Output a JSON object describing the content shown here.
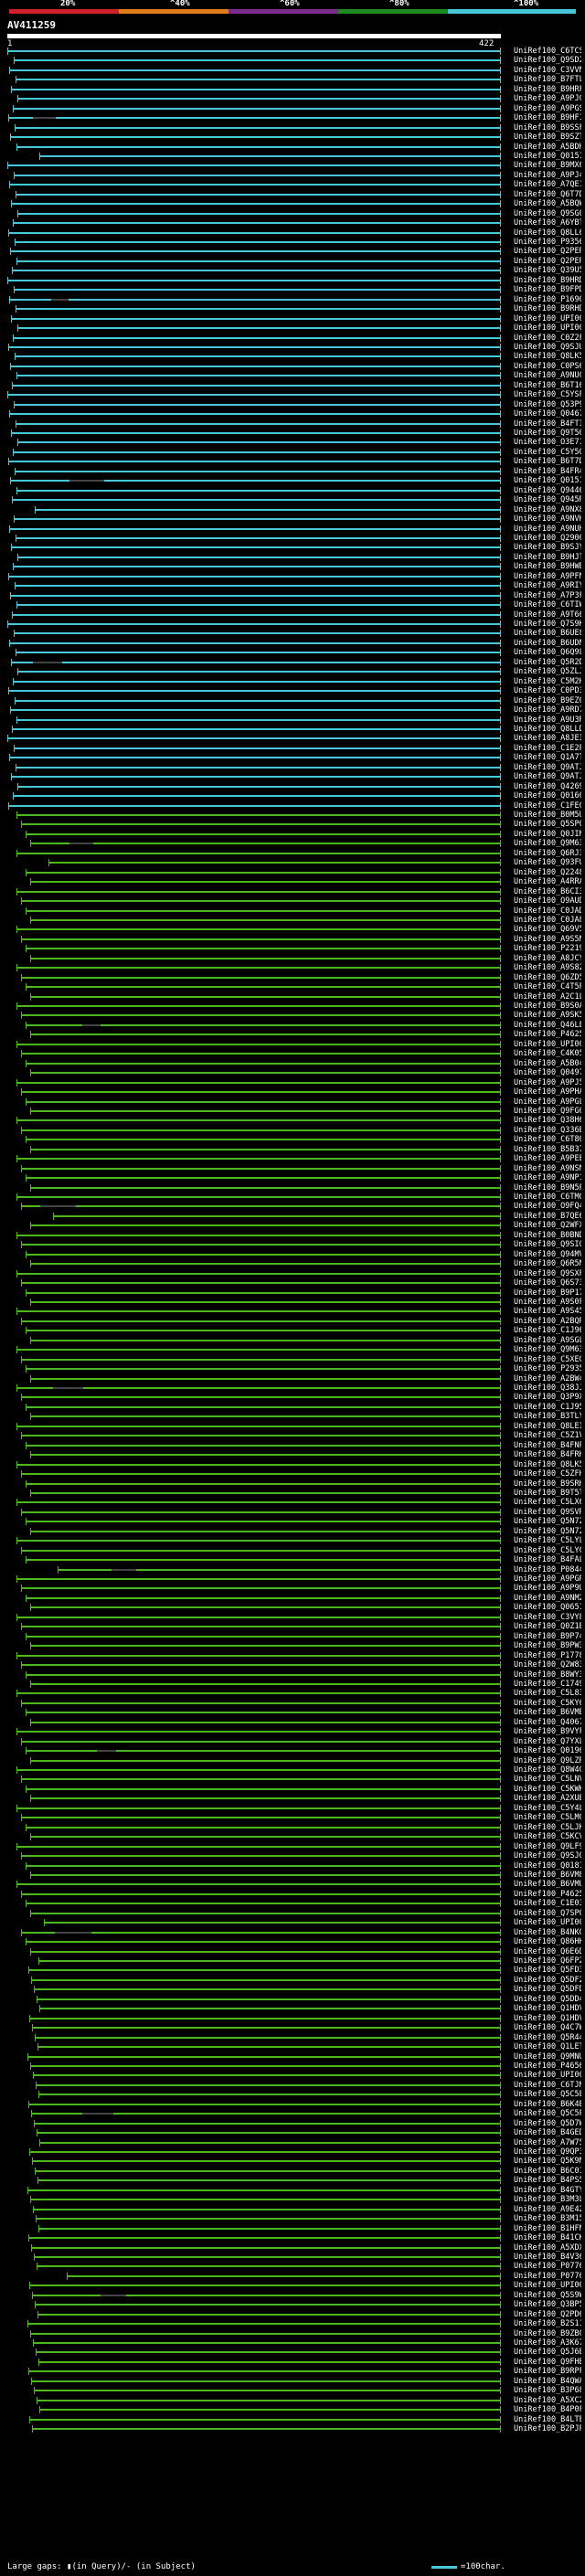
{
  "scale": {
    "labels": [
      "20%",
      "^40%",
      "^60%",
      "^80%",
      "^100%"
    ],
    "colors": [
      "#d0202a",
      "#e07b1a",
      "#7a2b8c",
      "#1f8a1f",
      "#46c8d8"
    ]
  },
  "query": {
    "title": "AV411259",
    "start": "1",
    "end": "422"
  },
  "colors": {
    "cyan": "#46c8d8",
    "green": "#4db81c"
  },
  "hits": [
    "UniRef100_C6TCS3",
    "UniRef100_Q9SD24",
    "UniRef100_C3VVN9",
    "UniRef100_B7FTL9",
    "UniRef100_B9HRF9",
    "UniRef100_A9PJC9",
    "UniRef100_A9PGS7",
    "UniRef100_B9HF14",
    "UniRef100_B9SSF5",
    "UniRef100_B9SZT9",
    "UniRef100_A5BDH7",
    "UniRef100_Q01516",
    "UniRef100_B9MX67",
    "UniRef100_A9PJ44",
    "UniRef100_A7QE19",
    "UniRef100_Q6T7D6",
    "UniRef100_A5BQW0",
    "UniRef100_Q9SG03",
    "UniRef100_A6YBT3",
    "UniRef100_Q8LL68",
    "UniRef100_P93565",
    "UniRef100_Q2PER4",
    "UniRef100_Q2PER4",
    "UniRef100_Q39U50",
    "UniRef100_B9HRD9",
    "UniRef100_B9FPD8",
    "UniRef100_P16906",
    "UniRef100_B9RHD4",
    "UniRef100_UPI000...",
    "UniRef100_UPI000...",
    "UniRef100_C0Z2F2",
    "UniRef100_Q9SJU4",
    "UniRef100_Q8LK59",
    "UniRef100_C0PS67",
    "UniRef100_A9NUC9",
    "UniRef100_B6T165",
    "UniRef100_C5YSP7",
    "UniRef100_Q53P96",
    "UniRef100_Q04677",
    "UniRef100_B4FTI5",
    "UniRef100_Q9T509",
    "UniRef100_O3E716",
    "UniRef100_C5Y5Q8",
    "UniRef100_B6T7D4",
    "UniRef100_B4FR47",
    "UniRef100_Q01517",
    "UniRef100_Q94469",
    "UniRef100_Q945R6",
    "UniRef100_A9NX85",
    "UniRef100_A9NVH7",
    "UniRef100_A9NUH5",
    "UniRef100_Q29000",
    "UniRef100_B9SJY9",
    "UniRef100_B9HJT3",
    "UniRef100_B9HWB3",
    "UniRef100_A9PFN5",
    "UniRef100_A9RIY9",
    "UniRef100_A7P3F7",
    "UniRef100_C6TIW0",
    "UniRef100_A9T663",
    "UniRef100_Q7S9K7",
    "UniRef100_B6UE86",
    "UniRef100_B6UDN1",
    "UniRef100_Q6Q9L9",
    "UniRef100_Q5R2D3",
    "UniRef100_Q5ZLJ0",
    "UniRef100_C5M2H1",
    "UniRef100_C0PD30",
    "UniRef100_B9EZ03",
    "UniRef100_A9RD76",
    "UniRef100_A9U3R4",
    "UniRef100_Q8LLD7",
    "UniRef100_A8JEI0",
    "UniRef100_C1E2P3",
    "UniRef100_Q1A7T7",
    "UniRef100_Q9ATJ0",
    "UniRef100_Q9ATJ1",
    "UniRef100_Q42690",
    "UniRef100_Q01600",
    "UniRef100_C1FEC9",
    "UniRef100_B0M5U3",
    "UniRef100_Q5SP09",
    "UniRef100_Q0JIM2",
    "UniRef100_Q9M633",
    "UniRef100_Q6RJ32",
    "UniRef100_Q93FU6",
    "UniRef100_Q22486",
    "UniRef100_A4RRA1",
    "UniRef100_B6CI36",
    "UniRef100_O9AUD9",
    "UniRef100_C0JAD2",
    "UniRef100_C0JA86",
    "UniRef100_Q69V57",
    "UniRef100_A9S5N9",
    "UniRef100_P22197",
    "UniRef100_A8JCY4",
    "UniRef100_A9S821",
    "UniRef100_Q6ZD51",
    "UniRef100_C4T5P1",
    "UniRef100_A2C1L8",
    "UniRef100_B9S0A4",
    "UniRef100_A9SK58",
    "UniRef100_Q46LE8",
    "UniRef100_P46256",
    "UniRef100_UPI000...",
    "UniRef100_C4K058",
    "UniRef100_A5B043",
    "UniRef100_Q04975",
    "UniRef100_A9PJ53",
    "UniRef100_A9PHA1",
    "UniRef100_A9PGL3",
    "UniRef100_Q9FG07",
    "UniRef100_Q38H64",
    "UniRef100_Q336B5",
    "UniRef100_C6T808",
    "UniRef100_B5B374",
    "UniRef100_A9PEE1",
    "UniRef100_A9NSN4",
    "UniRef100_A9NP14",
    "UniRef100_B9N5P0",
    "UniRef100_C6TMG1",
    "UniRef100_O9FQ46",
    "UniRef100_B7QE67",
    "UniRef100_Q2WFX0",
    "UniRef100_B0BND7",
    "UniRef100_Q9SIQ3",
    "UniRef100_Q94MV9",
    "UniRef100_Q6R5N7",
    "UniRef100_Q9SXP6",
    "UniRef100_Q6S735",
    "UniRef100_B9P179",
    "UniRef100_A9S0F9",
    "UniRef100_A9S450",
    "UniRef100_A2BQR8",
    "UniRef100_C1J960",
    "UniRef100_A9SGL4",
    "UniRef100_Q9M634",
    "UniRef100_C5XEQ7",
    "UniRef100_P29356",
    "UniRef100_A2BW48",
    "UniRef100_Q38JJ4",
    "UniRef100_Q3P9X3",
    "UniRef100_C1J959",
    "UniRef100_B3TLY1",
    "UniRef100_Q8LEI8",
    "UniRef100_C5Z1V3",
    "UniRef100_B4FNP9",
    "UniRef100_B4FRH3",
    "UniRef100_Q8LK58",
    "UniRef100_C5ZFH6",
    "UniRef100_B9SRH4",
    "UniRef100_B9T5T6",
    "UniRef100_C5LX67",
    "UniRef100_Q9SVR7",
    "UniRef100_Q5N725",
    "UniRef100_Q5N726",
    "UniRef100_C5LYL8",
    "UniRef100_C5LYC0",
    "UniRef100_B4FAL9",
    "UniRef100_P08440",
    "UniRef100_A9PGR9",
    "UniRef100_A9P9U1",
    "UniRef100_A9NM20",
    "UniRef100_Q06518",
    "UniRef100_C3VY85",
    "UniRef100_Q0Z1B5",
    "UniRef100_B9P741",
    "UniRef100_B9PW34",
    "UniRef100_P17784",
    "UniRef100_Q2W830",
    "UniRef100_B8WY35",
    "UniRef100_C17497",
    "UniRef100_C5L831",
    "UniRef100_C5KY69",
    "UniRef100_B6VMB7",
    "UniRef100_Q40676",
    "UniRef100_B9VYF4",
    "UniRef100_Q7YXL7",
    "UniRef100_Q01964",
    "UniRef100_Q9LZR9",
    "UniRef100_Q8W4G8",
    "UniRef100_C5LNV8",
    "UniRef100_C5KWK0",
    "UniRef100_A2XUB6",
    "UniRef100_C5Y4L0",
    "UniRef100_C5LMC2",
    "UniRef100_C5LJK3",
    "UniRef100_C5KCV7",
    "UniRef100_Q9LF98",
    "UniRef100_Q9SJQ9",
    "UniRef100_Q01812",
    "UniRef100_B6VM86",
    "UniRef100_B6VMU3",
    "UniRef100_P46257",
    "UniRef100_C1E032",
    "UniRef100_Q7SP03",
    "UniRef100_UPI000...",
    "UniRef100_B4NKG7",
    "UniRef100_Q86HK7",
    "UniRef100_Q6E6D2",
    "UniRef100_Q6FP29",
    "UniRef100_Q5FD38",
    "UniRef100_Q5DF28",
    "UniRef100_Q5DFD3",
    "UniRef100_Q5DD43",
    "UniRef100_Q1HDV3",
    "UniRef100_Q1HDV2",
    "UniRef100_Q4C7W5",
    "UniRef100_Q5R443",
    "UniRef100_Q1LET3",
    "UniRef100_Q9MNU1",
    "UniRef100_P46563",
    "UniRef100_UPI000...",
    "UniRef100_C6TJM1",
    "UniRef100_Q5C5E9",
    "UniRef100_B6K4B7",
    "UniRef100_Q5C5P7",
    "UniRef100_Q5D7W9",
    "UniRef100_B4GED5",
    "UniRef100_A7W751",
    "UniRef100_Q9QP32",
    "UniRef100_Q5K9N1",
    "UniRef100_B6C019",
    "UniRef100_B4PS51",
    "UniRef100_B4GTY1",
    "UniRef100_B3M3L8",
    "UniRef100_A9E428",
    "UniRef100_B3M153",
    "UniRef100_B1HFN7",
    "UniRef100_B41CK7",
    "UniRef100_A5XDX0",
    "UniRef100_B4V361",
    "UniRef100_P07764-3",
    "UniRef100_P07764",
    "UniRef100_UPI000...",
    "UniRef100_Q5S9W5",
    "UniRef100_Q3BP59",
    "UniRef100_Q2PD60",
    "UniRef100_B2S118",
    "UniRef100_B9ZBC9",
    "UniRef100_A3K67R",
    "UniRef100_Q5J6B4",
    "UniRef100_Q9FHB5",
    "UniRef100_B9RPF4",
    "UniRef100_B4QWA0",
    "UniRef100_B3P686",
    "UniRef100_A5XC24",
    "UniRef100_B4P0F7",
    "UniRef100_B4LTE9",
    "UniRef100_B2PJP7"
  ],
  "footer": {
    "gaps_text": "Large gaps: ▮(in Query)/‐ (in Subject)",
    "char_text": "=100char."
  }
}
